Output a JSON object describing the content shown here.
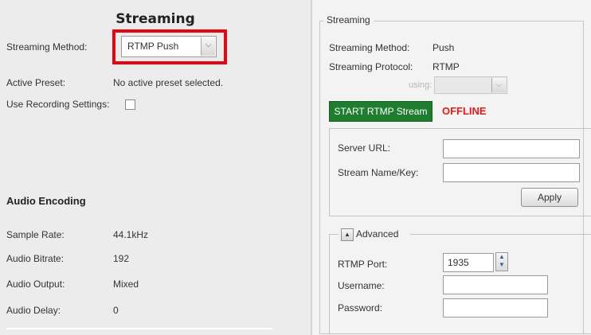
{
  "left": {
    "title": "Streaming",
    "streaming_method": {
      "label": "Streaming Method:",
      "value": "RTMP Push"
    },
    "active_preset": {
      "label": "Active Preset:",
      "value": "No active preset selected."
    },
    "use_recording_settings": {
      "label": "Use Recording Settings:",
      "checked": false
    },
    "audio_encoding": {
      "heading": "Audio Encoding",
      "rows": [
        {
          "label": "Sample Rate:",
          "value": "44.1kHz"
        },
        {
          "label": "Audio Bitrate:",
          "value": "192"
        },
        {
          "label": "Audio Output:",
          "value": "Mixed"
        },
        {
          "label": "Audio Delay:",
          "value": "0"
        }
      ]
    },
    "highlight_color": "#e30613"
  },
  "right": {
    "group_title": "Streaming",
    "streaming_method": {
      "label": "Streaming Method:",
      "value": "Push"
    },
    "streaming_protocol": {
      "label": "Streaming Protocol:",
      "value": "RTMP"
    },
    "using_label": "using:",
    "start_button": "START RTMP Stream",
    "status": "OFFLINE",
    "server_url": {
      "label": "Server URL:",
      "value": ""
    },
    "stream_key": {
      "label": "Stream Name/Key:",
      "value": ""
    },
    "apply_button": "Apply",
    "advanced": {
      "title": "Advanced",
      "rtmp_port": {
        "label": "RTMP Port:",
        "value": "1935"
      },
      "username": {
        "label": "Username:",
        "value": ""
      },
      "password": {
        "label": "Password:",
        "value": ""
      }
    }
  },
  "colors": {
    "start_button": "#1e7d2f",
    "status_offline": "#e21a1a"
  },
  "icons": {
    "dropdown": "chevron-down-icon",
    "spinner": "spinner-arrows-icon",
    "collapse": "collapse-up-icon"
  }
}
